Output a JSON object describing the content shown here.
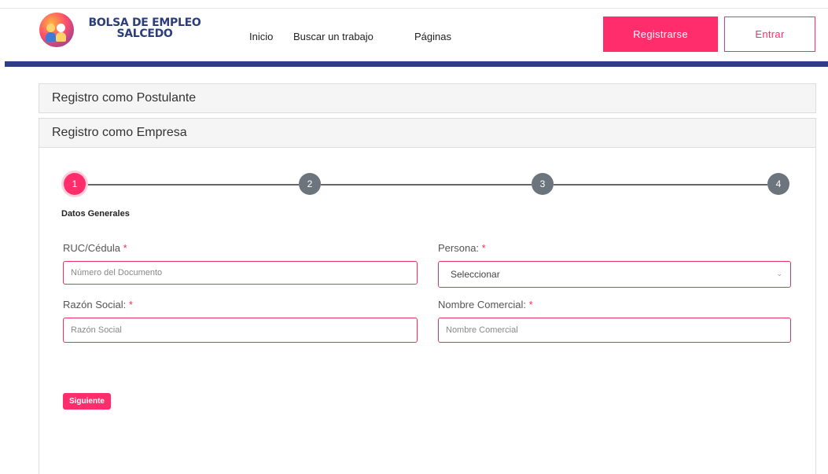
{
  "header": {
    "logo": {
      "line1": "BOLSA DE EMPLEO",
      "line2": "SALCEDO"
    },
    "nav": [
      {
        "label": "Inicio"
      },
      {
        "label": "Buscar un trabajo"
      },
      {
        "label": "Páginas"
      }
    ],
    "register_label": "Registrarse",
    "login_label": "Entrar"
  },
  "accordion": {
    "postulante_title": "Registro como Postulante",
    "empresa_title": "Registro como Empresa"
  },
  "stepper": {
    "steps": [
      "1",
      "2",
      "3",
      "4"
    ],
    "active_step": 1,
    "current_label": "Datos Generales"
  },
  "form": {
    "ruc": {
      "label": "RUC/Cédula",
      "required_mark": "*",
      "placeholder": "Número del Documento"
    },
    "persona": {
      "label": "Persona:",
      "required_mark": "*",
      "selected": "Seleccionar"
    },
    "razon_social": {
      "label": "Razón Social:",
      "required_mark": "*",
      "placeholder": "Razón Social"
    },
    "nombre_comercial": {
      "label": "Nombre Comercial:",
      "required_mark": "*",
      "placeholder": "Nombre Comercial"
    },
    "next_label": "Siguiente"
  },
  "colors": {
    "accent": "#ff2d6c",
    "navy": "#2f3c86",
    "step_inactive": "#6c757d"
  },
  "icons": {
    "select_chevron": "chevron-down-icon",
    "logo": "children-logo-icon"
  }
}
